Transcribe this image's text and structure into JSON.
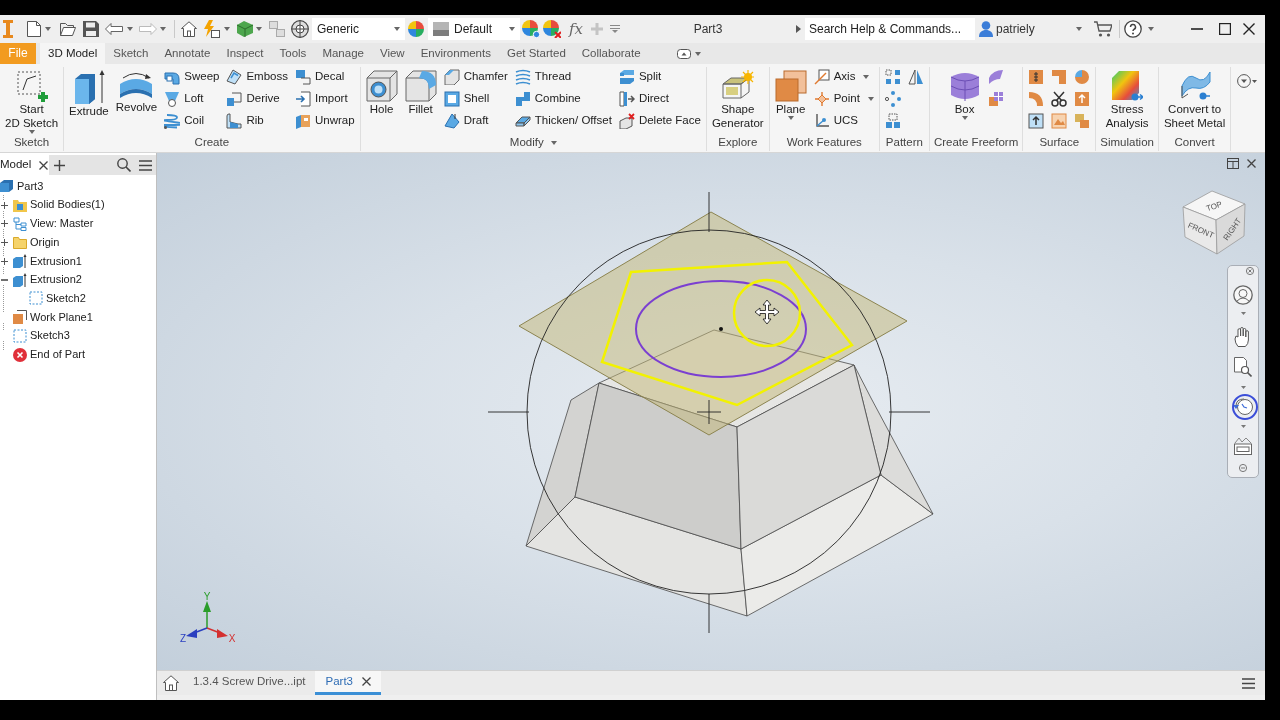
{
  "quick_access": {
    "material": "Generic",
    "appearance": "Default",
    "parameters": "fx"
  },
  "window_title": "Part3",
  "search": {
    "placeholder": "Search Help & Commands..."
  },
  "user": {
    "name": "patriely"
  },
  "ribbon_tabs": {
    "file": "File",
    "tabs": [
      {
        "label": "3D Model",
        "selected": true
      },
      {
        "label": "Sketch",
        "selected": false
      },
      {
        "label": "Annotate",
        "selected": false
      },
      {
        "label": "Inspect",
        "selected": false
      },
      {
        "label": "Tools",
        "selected": false
      },
      {
        "label": "Manage",
        "selected": false
      },
      {
        "label": "View",
        "selected": false
      },
      {
        "label": "Environments",
        "selected": false
      },
      {
        "label": "Get Started",
        "selected": false
      },
      {
        "label": "Collaborate",
        "selected": false
      }
    ]
  },
  "ribbon_panels": [
    {
      "title": "Sketch",
      "title_dropdown": false,
      "columns": [
        [
          {
            "kind": "large",
            "label": "Start\n2D Sketch",
            "dropdown": true
          }
        ]
      ]
    },
    {
      "title": "Create",
      "title_dropdown": false,
      "columns": [
        [
          {
            "kind": "large",
            "label": "Extrude",
            "dropdown": false
          }
        ],
        [
          {
            "kind": "large",
            "label": "Revolve",
            "dropdown": false
          }
        ],
        [
          {
            "kind": "small",
            "label": "Sweep",
            "dropdown": false
          },
          {
            "kind": "small",
            "label": "Loft",
            "dropdown": false
          },
          {
            "kind": "small",
            "label": "Coil",
            "dropdown": false
          }
        ],
        [
          {
            "kind": "small",
            "label": "Emboss",
            "dropdown": false
          },
          {
            "kind": "small",
            "label": "Derive",
            "dropdown": false
          },
          {
            "kind": "small",
            "label": "Rib",
            "dropdown": false
          }
        ],
        [
          {
            "kind": "small",
            "label": "Decal",
            "dropdown": false
          },
          {
            "kind": "small",
            "label": "Import",
            "dropdown": false
          },
          {
            "kind": "small",
            "label": "Unwrap",
            "dropdown": false
          }
        ]
      ]
    },
    {
      "title": "Modify",
      "title_dropdown": true,
      "columns": [
        [
          {
            "kind": "large",
            "label": "Hole",
            "dropdown": false
          }
        ],
        [
          {
            "kind": "large",
            "label": "Fillet",
            "dropdown": false
          }
        ],
        [
          {
            "kind": "small",
            "label": "Chamfer",
            "dropdown": false
          },
          {
            "kind": "small",
            "label": "Shell",
            "dropdown": false
          },
          {
            "kind": "small",
            "label": "Draft",
            "dropdown": false
          }
        ],
        [
          {
            "kind": "small",
            "label": "Thread",
            "dropdown": false
          },
          {
            "kind": "small",
            "label": "Combine",
            "dropdown": false
          },
          {
            "kind": "small",
            "label": "Thicken/ Offset",
            "dropdown": false
          }
        ],
        [
          {
            "kind": "small",
            "label": "Split",
            "dropdown": false
          },
          {
            "kind": "small",
            "label": "Direct",
            "dropdown": false
          },
          {
            "kind": "small",
            "label": "Delete Face",
            "dropdown": false
          }
        ]
      ]
    },
    {
      "title": "Explore",
      "title_dropdown": false,
      "columns": [
        [
          {
            "kind": "large",
            "label": "Shape\nGenerator",
            "dropdown": false
          }
        ]
      ]
    },
    {
      "title": "Work Features",
      "title_dropdown": false,
      "columns": [
        [
          {
            "kind": "large",
            "label": "Plane",
            "dropdown": true
          }
        ],
        [
          {
            "kind": "small",
            "label": "Axis",
            "dropdown": true
          },
          {
            "kind": "small",
            "label": "Point",
            "dropdown": true
          },
          {
            "kind": "small",
            "label": "UCS",
            "dropdown": false
          }
        ]
      ]
    },
    {
      "title": "Pattern",
      "title_dropdown": false,
      "columns": [
        [
          {
            "kind": "icon",
            "dropdown": false
          },
          {
            "kind": "icon",
            "dropdown": false
          },
          {
            "kind": "icon",
            "dropdown": false
          }
        ],
        [
          {
            "kind": "icon",
            "dropdown": false
          }
        ]
      ]
    },
    {
      "title": "Create Freeform",
      "title_dropdown": false,
      "columns": [
        [
          {
            "kind": "large",
            "label": "Box",
            "dropdown": true
          }
        ],
        [
          {
            "kind": "icon",
            "dropdown": false
          },
          {
            "kind": "icon",
            "dropdown": false
          }
        ]
      ]
    },
    {
      "title": "Surface",
      "title_dropdown": false,
      "columns": [
        [
          {
            "kind": "icon",
            "dropdown": false
          },
          {
            "kind": "icon",
            "dropdown": false
          },
          {
            "kind": "icon",
            "dropdown": false
          }
        ],
        [
          {
            "kind": "icon",
            "dropdown": false
          },
          {
            "kind": "icon",
            "dropdown": false
          },
          {
            "kind": "icon",
            "dropdown": false
          }
        ],
        [
          {
            "kind": "icon",
            "dropdown": false
          },
          {
            "kind": "icon",
            "dropdown": false
          },
          {
            "kind": "icon",
            "dropdown": false
          }
        ]
      ]
    },
    {
      "title": "Simulation",
      "title_dropdown": false,
      "columns": [
        [
          {
            "kind": "large",
            "label": "Stress\nAnalysis",
            "dropdown": false
          }
        ]
      ]
    },
    {
      "title": "Convert",
      "title_dropdown": false,
      "columns": [
        [
          {
            "kind": "large",
            "label": "Convert to\nSheet Metal",
            "dropdown": false
          }
        ]
      ]
    }
  ],
  "browser": {
    "tab": "Model",
    "tree": [
      {
        "label": "Part3",
        "kind": "part",
        "selected": false,
        "children": [
          {
            "label": "Solid Bodies(1)",
            "kind": "bodies",
            "selected": false,
            "expanded": false
          },
          {
            "label": "View: Master",
            "kind": "view",
            "selected": false,
            "expanded": false
          },
          {
            "label": "Origin",
            "kind": "folder",
            "selected": false,
            "expanded": false
          },
          {
            "label": "Extrusion1",
            "kind": "extrusion",
            "selected": false,
            "expanded": false
          },
          {
            "label": "Extrusion2",
            "kind": "extrusion",
            "selected": false,
            "expanded": true,
            "children": [
              {
                "label": "Sketch2",
                "kind": "sketch",
                "selected": false
              }
            ]
          },
          {
            "label": "Work Plane1",
            "kind": "plane",
            "selected": false
          },
          {
            "label": "Sketch3",
            "kind": "sketch",
            "selected": false
          },
          {
            "label": "End of Part",
            "kind": "end",
            "selected": false
          }
        ]
      }
    ]
  },
  "viewport": {
    "view_cube": {
      "top": "TOP",
      "front": "FRONT",
      "right": "RIGHT"
    },
    "axis_labels": {
      "y": "Y",
      "z": "Z",
      "x": "X"
    }
  },
  "documents": [
    {
      "label": "1.3.4 Screw Drive...ipt",
      "selected": false,
      "closable": false
    },
    {
      "label": "Part3",
      "selected": true,
      "closable": true
    }
  ]
}
